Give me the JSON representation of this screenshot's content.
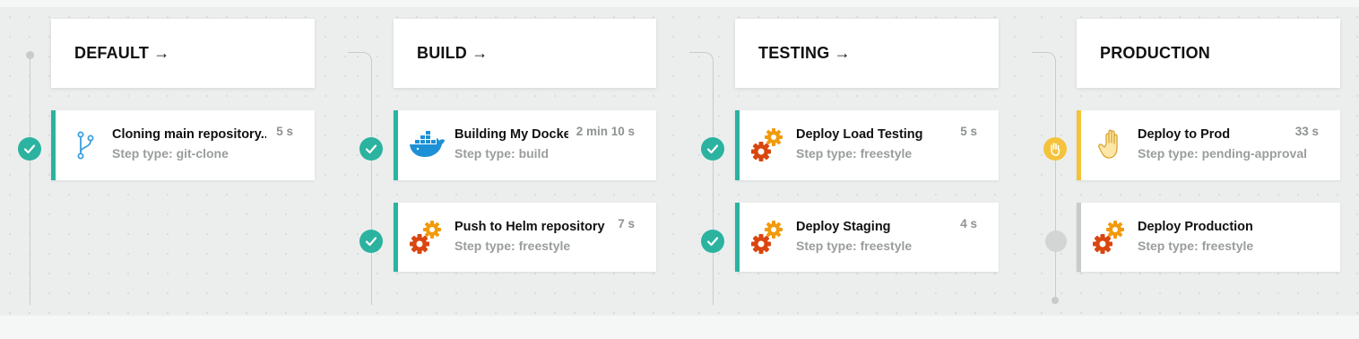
{
  "colors": {
    "success": "#2bb3a0",
    "pending": "#f5c33b",
    "idle": "#c9cbcb"
  },
  "stages": [
    {
      "title": "DEFAULT",
      "arrow": "→",
      "steps": [
        {
          "name": "Cloning main repository...",
          "type": "Step type: git-clone",
          "duration": "5 s",
          "status": "success",
          "icon": "git-branch-icon"
        }
      ]
    },
    {
      "title": "BUILD",
      "arrow": "→",
      "steps": [
        {
          "name": "Building My Docke",
          "type": "Step type: build",
          "duration": "2 min 10 s",
          "status": "success",
          "icon": "docker-whale-icon"
        },
        {
          "name": "Push to Helm repository",
          "type": "Step type: freestyle",
          "duration": "7 s",
          "status": "success",
          "icon": "gears-icon"
        }
      ]
    },
    {
      "title": "TESTING",
      "arrow": "→",
      "steps": [
        {
          "name": "Deploy Load Testing",
          "type": "Step type: freestyle",
          "duration": "5 s",
          "status": "success",
          "icon": "gears-icon"
        },
        {
          "name": "Deploy Staging",
          "type": "Step type: freestyle",
          "duration": "4 s",
          "status": "success",
          "icon": "gears-icon"
        }
      ]
    },
    {
      "title": "PRODUCTION",
      "arrow": "",
      "steps": [
        {
          "name": "Deploy to Prod",
          "type": "Step type: pending-approval",
          "duration": "33 s",
          "status": "pending",
          "icon": "hand-icon"
        },
        {
          "name": "Deploy Production",
          "type": "Step type: freestyle",
          "duration": "",
          "status": "idle",
          "icon": "gears-icon"
        }
      ]
    }
  ]
}
